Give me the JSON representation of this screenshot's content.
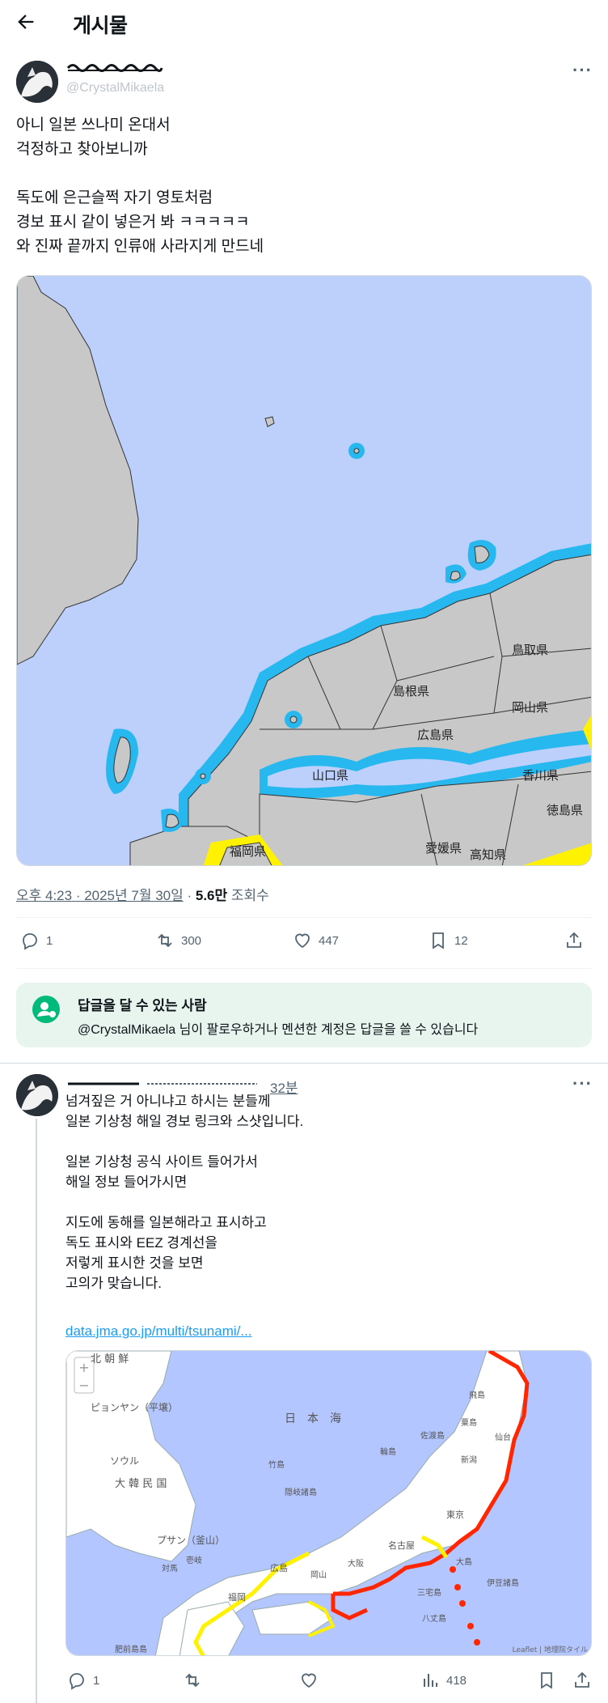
{
  "header": {
    "title": "게시물"
  },
  "post": {
    "author_handle": "@CrystalMikaela",
    "text": "아니 일본 쓰나미 온대서\n걱정하고 찾아보니까\n\n독도에 은근슬쩍 자기 영토처럼\n경보 표시 같이 넣은거 봐 ㅋㅋㅋㅋㅋ\n와 진짜 끝까지 인류애 사라지게 만드네",
    "map_labels": [
      "鳥取県",
      "島根県",
      "岡山県",
      "広島県",
      "山口県",
      "香川県",
      "徳島県",
      "福岡県",
      "愛媛県",
      "高知県"
    ],
    "time": "오후 4:23 · 2025년 7월 30일",
    "views_value": "5.6만",
    "views_label": "조회수",
    "stats": {
      "replies": "1",
      "reposts": "300",
      "likes": "447",
      "bookmarks": "12"
    },
    "reply_box": {
      "title": "답글을 달 수 있는 사람",
      "handle": "@CrystalMikaela",
      "desc": " 님이 팔로우하거나 멘션한 계정은 답글을 쓸 수 있습니다"
    }
  },
  "reply": {
    "time": "32분",
    "text": "넘겨짚은 거 아니냐고 하시는 분들께\n일본 기상청 해일 경보 링크와 스샷입니다.\n\n일본 기상청 공식 사이트 들어가서\n해일 정보 들어가시면\n\n지도에 동해를 일본해라고 표시하고\n독도 표시와 EEZ 경계선을\n저렇게 표시한 것을 보면\n고의가 맞습니다.",
    "link": "data.jma.go.jp/multi/tsunami/...",
    "map_labels": {
      "north_korea": "北 朝 鮮",
      "pyongyang": "ピョンヤン（平壌）",
      "seoul": "ソウル",
      "south_korea": "大 韓 民 国",
      "busan": "プサン（釜山）",
      "tsushima": "対馬",
      "iki": "壱岐",
      "fukuoka": "福岡",
      "hizen": "肥前島島",
      "sea_of_japan": "日　本　海",
      "takeshima": "竹島",
      "oki": "隠岐諸島",
      "wajima": "輪島",
      "sado": "佐渡島",
      "tobishima": "飛島",
      "awashima": "粟島",
      "niigata": "新潟",
      "hiroshima": "広島",
      "okayama": "岡山",
      "osaka": "大阪",
      "nagoya": "名古屋",
      "tokyo": "東京",
      "sendai": "仙台",
      "oshima": "大島",
      "miyake": "三宅島",
      "hachijo": "八丈島",
      "izu": "伊豆諸島",
      "attribution": "Leaflet | 地理院タイル",
      "zoom_in": "+",
      "zoom_out": "−"
    },
    "stats": {
      "replies": "1",
      "views": "418"
    }
  },
  "colors": {
    "accent": "#1d9bf0",
    "like": "#f91880",
    "green": "#00ba7c",
    "sea_map1": "#bcd0fb",
    "land": "#c8c8c8",
    "warning_cyan": "#27b8ef",
    "warning_yellow": "#fff200",
    "warning_red": "#ff2600",
    "sea_map2": "#b3c6ff"
  }
}
